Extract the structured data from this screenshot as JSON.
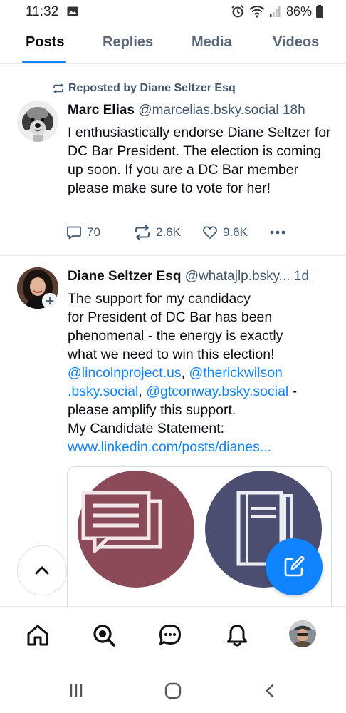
{
  "status_bar": {
    "time": "11:32",
    "battery_percent": "86%"
  },
  "tabs": [
    "Posts",
    "Replies",
    "Media",
    "Videos"
  ],
  "active_tab": "Posts",
  "posts": [
    {
      "repost_label": "Reposted by Diane Seltzer Esq",
      "author_name": "Marc Elias",
      "author_handle": "@marcelias.bsky.social",
      "timestamp": "18h",
      "text": "I enthusiastically endorse Diane Seltzer for DC Bar President. The election is coming up soon. If you are a DC Bar member please make sure to vote for her!",
      "reply_count": "70",
      "repost_count": "2.6K",
      "like_count": "9.6K"
    },
    {
      "author_name": "Diane Seltzer Esq",
      "author_handle": "@whatajlp.bsky...",
      "timestamp": "1d",
      "text_lines": [
        "The support for my candidacy",
        "for President of DC Bar has been",
        "phenomenal - the energy is exactly",
        "what we need to win this election!"
      ],
      "mention_1": "@lincolnproject.us",
      "comma_1": ", ",
      "mention_2a": "@therickwilson",
      "mention_2b": ".bsky.social",
      "comma_2": ", ",
      "mention_3": "@gtconway.bsky.social",
      "after_mentions": " -",
      "line_amplify": "please amplify this support.",
      "line_statement": "My Candidate Statement:",
      "link_text": "www.linkedin.com/posts/dianes..."
    }
  ],
  "colors": {
    "accent": "#1083fe",
    "muted_text": "#42576c",
    "embed_left_circle": "#8b4a58",
    "embed_right_circle": "#4b4e70"
  },
  "icons": {
    "repost": "repost-icon",
    "reply": "reply-icon",
    "like": "heart-icon",
    "more": "more-icon",
    "home": "home-icon",
    "search": "search-icon",
    "chat": "chat-icon",
    "notifications": "bell-icon",
    "compose": "compose-icon",
    "scroll_top": "chevron-up-icon"
  }
}
